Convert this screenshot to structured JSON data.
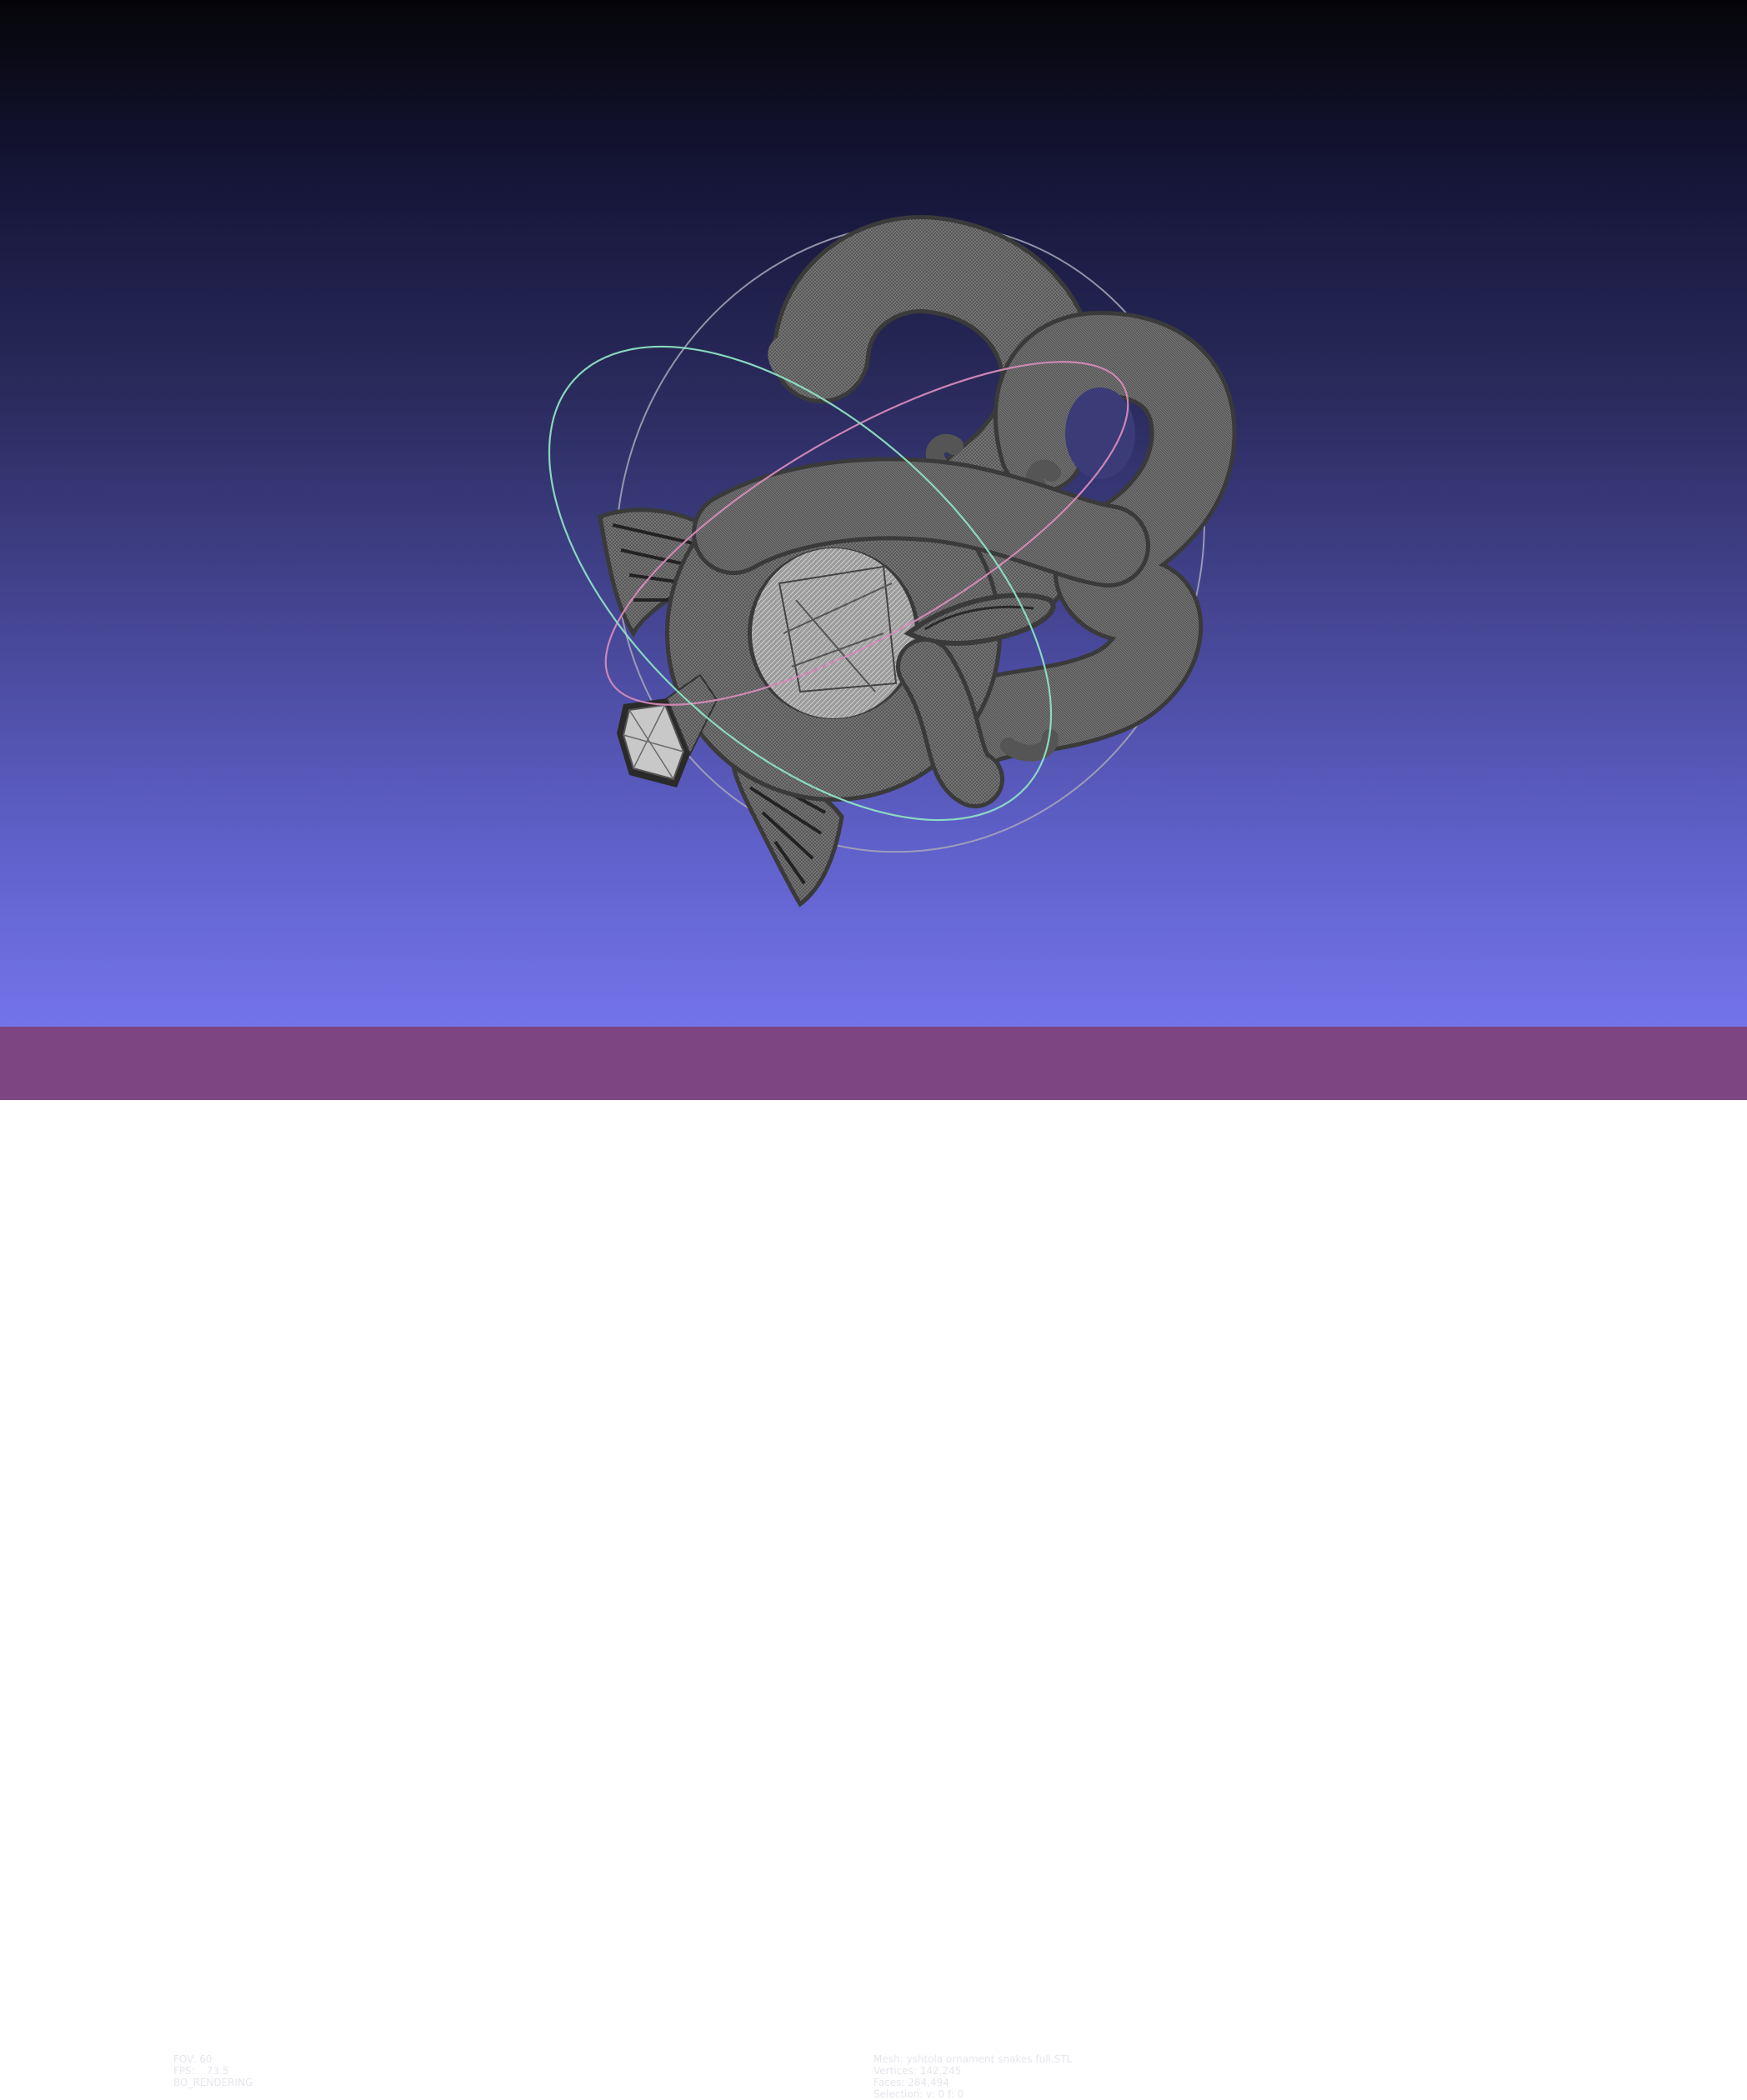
{
  "viewer": {
    "background_top": "#050508",
    "background_bottom": "#7474ea",
    "statusbar_color": "#7d4682",
    "mesh_color": "#4a4a4a"
  },
  "left_info": {
    "fov_label": "FOV:",
    "fov_value": "60",
    "fps_label": "FPS:",
    "fps_value": "73.5",
    "render_mode": "BO_RENDERING"
  },
  "right_info": {
    "mesh": "Mesh: yshtola ornament snakes full.STL",
    "vertices": "Vertices: 142,245",
    "faces": "Faces: 284,494",
    "selection": "Selection: v: 0 f: 0"
  }
}
